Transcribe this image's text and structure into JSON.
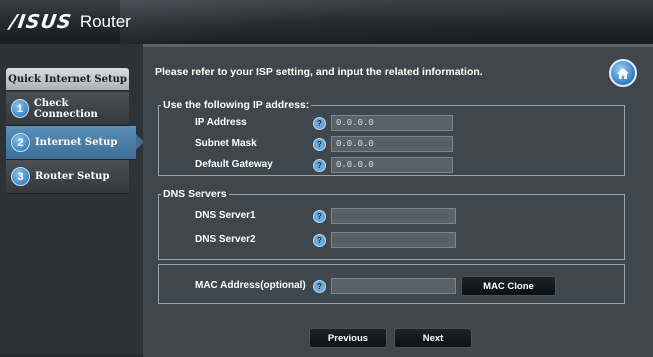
{
  "header": {
    "brand": "/ISUS",
    "product": "Router"
  },
  "sidebar": {
    "title": "Quick Internet Setup",
    "steps": [
      {
        "num": "1",
        "label": "Check Connection"
      },
      {
        "num": "2",
        "label": "Internet Setup"
      },
      {
        "num": "3",
        "label": "Router Setup"
      }
    ]
  },
  "main": {
    "instruction": "Please refer to your ISP setting, and input the related information.",
    "ip_group": {
      "legend": "Use the following IP address:",
      "ip_label": "IP Address",
      "ip_value": "0.0.0.0",
      "mask_label": "Subnet Mask",
      "mask_value": "0.0.0.0",
      "gw_label": "Default Gateway",
      "gw_value": "0.0.0.0"
    },
    "dns_group": {
      "legend": "DNS Servers",
      "dns1_label": "DNS Server1",
      "dns1_value": "",
      "dns2_label": "DNS Server2",
      "dns2_value": ""
    },
    "mac": {
      "label": "MAC Address(optional)",
      "value": "",
      "clone_button": "MAC Clone"
    },
    "help_glyph": "?",
    "previous_button": "Previous",
    "next_button": "Next"
  },
  "colors": {
    "accent": "#3e6e95",
    "background": "#3f474c"
  }
}
